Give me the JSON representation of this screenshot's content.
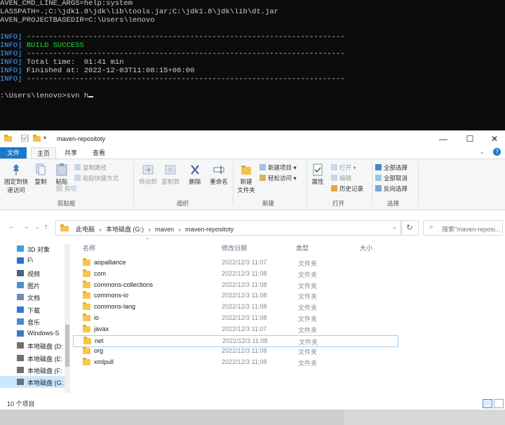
{
  "terminal": {
    "lines": [
      "AVEN_CMD_LINE_ARGS=help:system",
      "LASSPATH=.;C:\\jdk1.8\\jdk\\lib\\tools.jar;C:\\jdk1.8\\jdk\\lib\\dt.jar",
      "AVEN_PROJECTBASEDIR=C:\\Users\\lenovo",
      "",
      "INFO] ------------------------------------------------------------------------",
      "INFO] BUILD SUCCESS",
      "INFO] ------------------------------------------------------------------------",
      "INFO] Total time:  01:41 min",
      "INFO] Finished at: 2022-12-03T11:08:15+08:00",
      "INFO] ------------------------------------------------------------------------",
      "",
      ":\\Users\\lenovo>svn h"
    ],
    "colors": {
      "info": "#4aa3ff",
      "success": "#29d43c",
      "text": "#cfcfcf"
    }
  },
  "window": {
    "title": "maven-repositoty",
    "controls": {
      "minimize": "—",
      "maximize": "☐",
      "close": "✕"
    },
    "tabs": [
      "文件",
      "主页",
      "共享",
      "查看"
    ],
    "ribbon": {
      "clipboard": {
        "pin": "固定到快",
        "pin2": "速访问",
        "copy": "复制",
        "paste": "粘贴",
        "copy_path": "复制路径",
        "paste_shortcut": "粘贴快捷方式",
        "cut": "剪切",
        "label": "剪贴板"
      },
      "organize": {
        "move_to": "移动到",
        "copy_to": "复制到",
        "delete": "删除",
        "rename": "重命名",
        "label": "组织"
      },
      "new": {
        "new_folder": "新建",
        "new_folder2": "文件夹",
        "new_item": "新建项目 ▾",
        "easy_access": "轻松访问 ▾",
        "label": "新建"
      },
      "open": {
        "properties": "属性",
        "open": "打开 ▾",
        "edit": "编辑",
        "history": "历史记录",
        "label": "打开"
      },
      "select": {
        "select_all": "全部选择",
        "select_none": "全部取消",
        "invert": "反向选择",
        "label": "选择"
      }
    },
    "address": {
      "crumbs": [
        "此电脑",
        "›",
        "本地磁盘 (G:)",
        "›",
        "maven",
        "›",
        "maven-repositoty"
      ],
      "search_placeholder": "搜索\"maven-reposi..."
    },
    "nav": [
      {
        "label": "3D 对象",
        "icon": "3d-objects-icon",
        "color": "#3aa0e6"
      },
      {
        "label": "F\\",
        "icon": "folder-icon",
        "color": "#2e6fd0"
      },
      {
        "label": "视频",
        "icon": "video-icon",
        "color": "#4a5f7a"
      },
      {
        "label": "图片",
        "icon": "pictures-icon",
        "color": "#4a8fd6"
      },
      {
        "label": "文档",
        "icon": "documents-icon",
        "color": "#6f8db3"
      },
      {
        "label": "下载",
        "icon": "download-icon",
        "color": "#2f7ad6"
      },
      {
        "label": "音乐",
        "icon": "music-icon",
        "color": "#4a86d8"
      },
      {
        "label": "Windows-S",
        "icon": "drive-icon",
        "color": "#3a78c8"
      },
      {
        "label": "本地磁盘 (D:",
        "icon": "drive-icon",
        "color": "#707070"
      },
      {
        "label": "本地磁盘 (E:",
        "icon": "drive-icon",
        "color": "#707070"
      },
      {
        "label": "本地磁盘 (F:",
        "icon": "drive-icon",
        "color": "#707070"
      },
      {
        "label": "本地磁盘 (G:",
        "icon": "drive-icon",
        "color": "#707070"
      }
    ],
    "columns": {
      "name": "名称",
      "date": "修改日期",
      "type": "类型",
      "size": "大小"
    },
    "files": [
      {
        "name": "aopalliance",
        "date": "2022/12/3 11:07",
        "type": "文件夹"
      },
      {
        "name": "com",
        "date": "2022/12/3 11:08",
        "type": "文件夹"
      },
      {
        "name": "commons-collections",
        "date": "2022/12/3 11:08",
        "type": "文件夹"
      },
      {
        "name": "commons-io",
        "date": "2022/12/3 11:08",
        "type": "文件夹"
      },
      {
        "name": "commons-lang",
        "date": "2022/12/3 11:08",
        "type": "文件夹"
      },
      {
        "name": "io",
        "date": "2022/12/3 11:08",
        "type": "文件夹"
      },
      {
        "name": "javax",
        "date": "2022/12/3 11:07",
        "type": "文件夹"
      },
      {
        "name": "net",
        "date": "2022/12/3 11:08",
        "type": "文件夹"
      },
      {
        "name": "org",
        "date": "2022/12/3 11:08",
        "type": "文件夹"
      },
      {
        "name": "xmlpull",
        "date": "2022/12/3 11:08",
        "type": "文件夹"
      }
    ],
    "selected_file": "net",
    "status": "10 个项目"
  }
}
